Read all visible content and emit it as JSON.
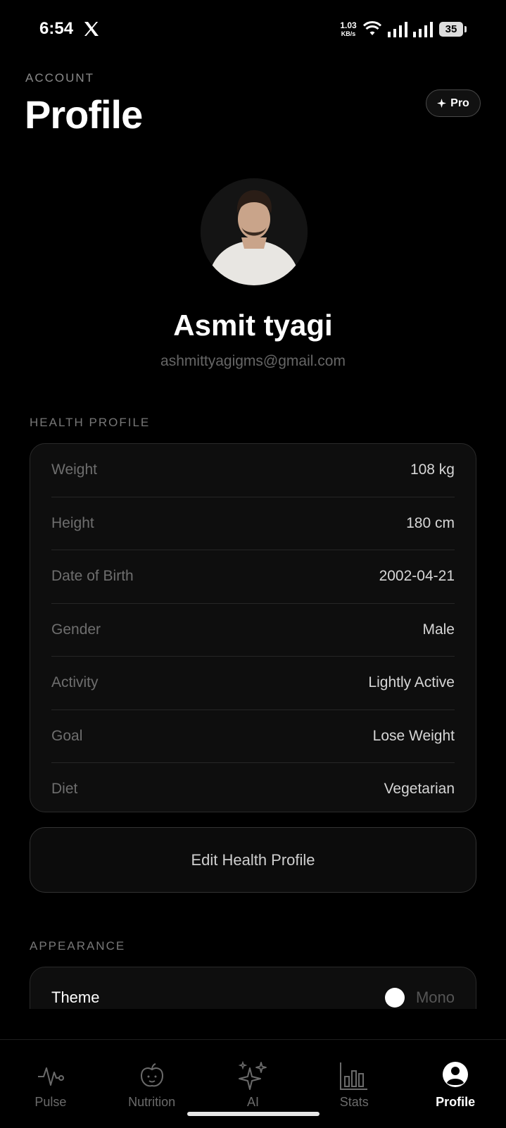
{
  "status_bar": {
    "time": "6:54",
    "network_speed_value": "1.03",
    "network_speed_unit": "KB/s",
    "battery": "35"
  },
  "header": {
    "eyebrow": "ACCOUNT",
    "title": "Profile",
    "pro_badge": "Pro"
  },
  "user": {
    "name": "Asmit tyagi",
    "email": "ashmittyagigms@gmail.com"
  },
  "health_profile": {
    "section_label": "HEALTH PROFILE",
    "rows": [
      {
        "label": "Weight",
        "value": "108 kg"
      },
      {
        "label": "Height",
        "value": "180 cm"
      },
      {
        "label": "Date of Birth",
        "value": "2002-04-21"
      },
      {
        "label": "Gender",
        "value": "Male"
      },
      {
        "label": "Activity",
        "value": "Lightly Active"
      },
      {
        "label": "Goal",
        "value": "Lose Weight"
      },
      {
        "label": "Diet",
        "value": "Vegetarian"
      }
    ],
    "edit_button": "Edit Health Profile"
  },
  "appearance": {
    "section_label": "APPEARANCE",
    "theme_label": "Theme",
    "theme_value": "Mono"
  },
  "bottom_nav": {
    "items": [
      {
        "label": "Pulse",
        "icon": "pulse-icon"
      },
      {
        "label": "Nutrition",
        "icon": "apple-icon"
      },
      {
        "label": "AI",
        "icon": "sparkles-icon"
      },
      {
        "label": "Stats",
        "icon": "bar-chart-icon"
      },
      {
        "label": "Profile",
        "icon": "user-circle-icon"
      }
    ],
    "active": "Profile"
  }
}
